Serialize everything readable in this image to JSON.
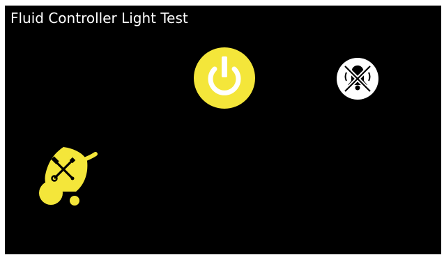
{
  "screen": {
    "title": "Fluid Controller Light Test"
  },
  "icons": {
    "power": "power-icon",
    "alarm_mute": "alarm-mute-icon",
    "service_tools": "service-tools-icon"
  },
  "colors": {
    "background": "#000000",
    "accent_yellow": "#f4e63a",
    "text": "#ffffff",
    "mute_badge": "#ffffff"
  }
}
